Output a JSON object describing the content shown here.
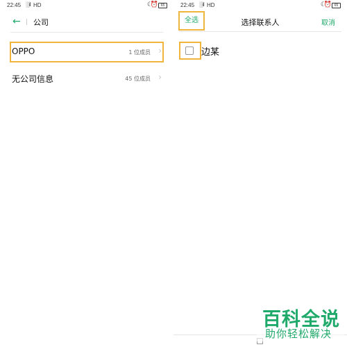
{
  "left": {
    "status": {
      "time": "22:45",
      "signal": "░ıl",
      "network": "HD",
      "battery": "65"
    },
    "nav": {
      "title": "公司"
    },
    "companies": [
      {
        "name": "OPPO",
        "count": "1 位成员"
      },
      {
        "name": "无公司信息",
        "count": "45 位成员"
      }
    ]
  },
  "right": {
    "status": {
      "time": "22:45",
      "signal": "░ıl",
      "network": "HD",
      "battery": "65"
    },
    "header": {
      "select_all": "全选",
      "title": "选择联系人",
      "cancel": "取消"
    },
    "contacts": [
      {
        "name": "边某",
        "checked": false
      }
    ]
  },
  "watermark": {
    "line1": "百科全说",
    "line2": "助你轻松解决"
  },
  "colors": {
    "accent": "#1fa96a",
    "highlight": "#f0b53b"
  }
}
